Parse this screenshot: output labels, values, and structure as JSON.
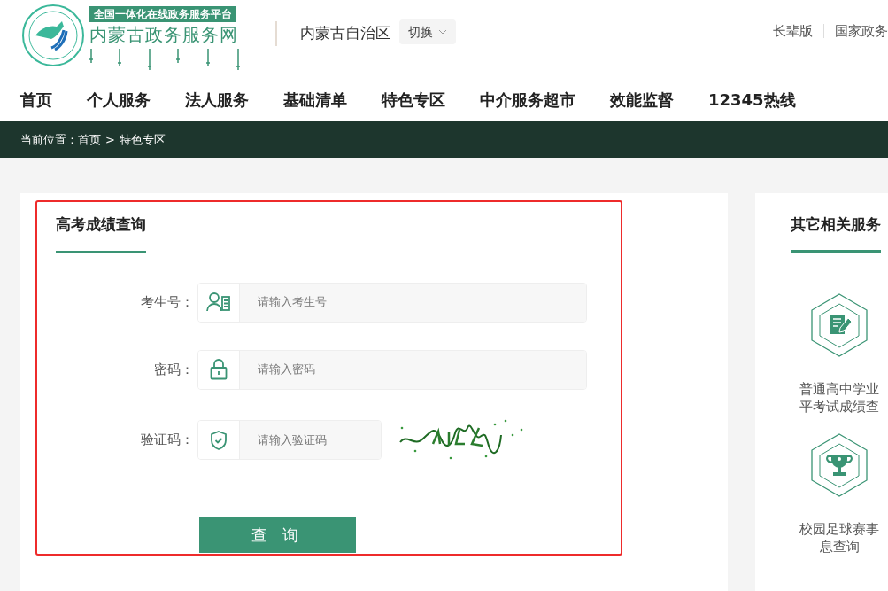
{
  "header": {
    "platform_badge": "全国一体化在线政务服务平台",
    "site_name": "内蒙古政务服务网",
    "region": "内蒙古自治区",
    "switch_button": "切换",
    "top_links": [
      "长辈版",
      "国家政务"
    ]
  },
  "nav": [
    {
      "label": "首页"
    },
    {
      "label": "个人服务"
    },
    {
      "label": "法人服务"
    },
    {
      "label": "基础清单"
    },
    {
      "label": "特色专区"
    },
    {
      "label": "中介服务超市"
    },
    {
      "label": "效能监督"
    },
    {
      "label": "12345热线"
    }
  ],
  "breadcrumb": {
    "prefix": "当前位置：",
    "items": [
      "首页",
      "特色专区"
    ],
    "separator": ">"
  },
  "form_card": {
    "title": "高考成绩查询",
    "fields": [
      {
        "kind": "id",
        "label": "考生号：",
        "placeholder": "请输入考生号"
      },
      {
        "kind": "password",
        "label": "密码：",
        "placeholder": "请输入密码"
      },
      {
        "kind": "captcha",
        "label": "验证码：",
        "placeholder": "请输入验证码"
      }
    ],
    "submit": "查 询"
  },
  "side_panel": {
    "title": "其它相关服务",
    "services": [
      {
        "kind": "document",
        "lines": [
          "普通高中学业",
          "平考试成绩查"
        ]
      },
      {
        "kind": "trophy",
        "lines": [
          "校园足球赛事",
          "息查询"
        ]
      }
    ]
  }
}
